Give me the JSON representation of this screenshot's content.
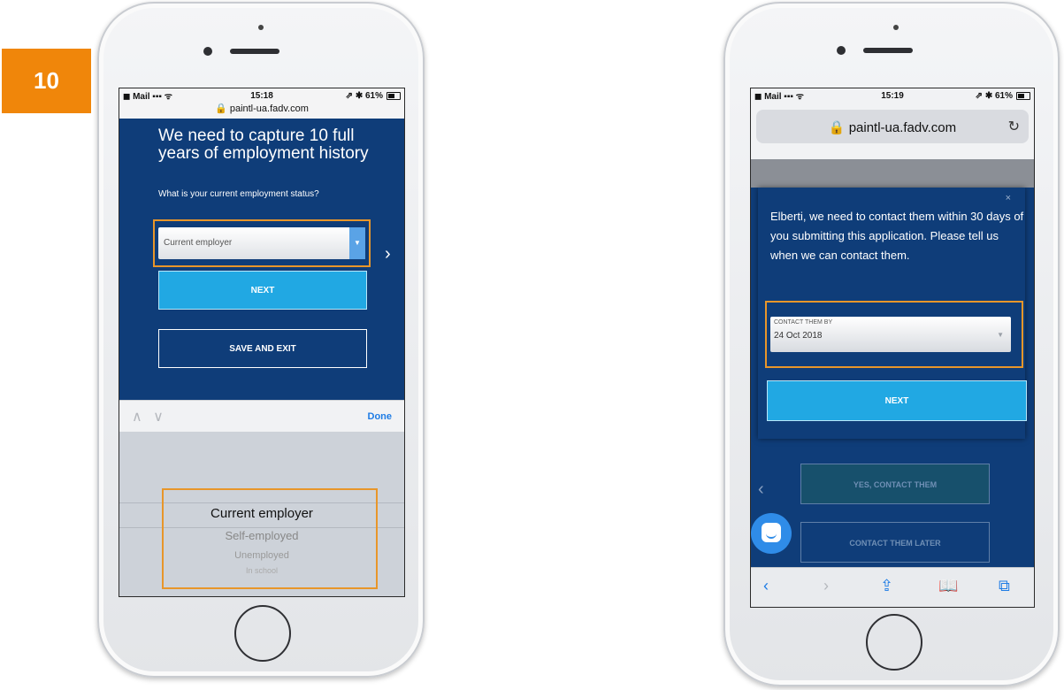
{
  "step_number": "10",
  "phone1": {
    "status": {
      "carrier": "◼ Mail ▪▪▪ ᯤ",
      "time": "15:18",
      "right": "⇗ ✱ 61%"
    },
    "url": "🔒 paintl-ua.fadv.com",
    "headline": "We need to capture 10 full years of employment history",
    "question": "What is your current employment status?",
    "select_value": "Current employer",
    "next_label": "NEXT",
    "save_exit_label": "SAVE AND EXIT",
    "keyboard": {
      "arrows": "∧ ∨",
      "done_label": "Done"
    },
    "picker_options": [
      "Current employer",
      "Self-employed",
      "Unemployed",
      "In school"
    ]
  },
  "phone2": {
    "status": {
      "carrier": "◼ Mail ▪▪▪ ᯤ",
      "time": "15:19",
      "right": "⇗ ✱ 61%"
    },
    "url_host": "🔒 paintl-ua.fadv.com",
    "reload_icon": "↻",
    "close_label": "×",
    "message": "Elberti, we need to contact them within 30 days of you submitting this application. Please tell us when we can contact them.",
    "contact_label": "CONTACT THEM BY",
    "contact_date": "24 Oct 2018",
    "next_label": "NEXT",
    "yes_contact_label": "YES, CONTACT THEM",
    "contact_later_label": "CONTACT THEM LATER",
    "toolbar": {
      "back": "‹",
      "forward": "›",
      "share": "⇪",
      "bookmarks": "📖",
      "tabs": "⧉"
    }
  },
  "colors": {
    "brand_blue": "#0f3d79",
    "button_blue": "#21a8e3",
    "highlight_orange": "#e8962a",
    "badge_orange": "#f0860a"
  }
}
